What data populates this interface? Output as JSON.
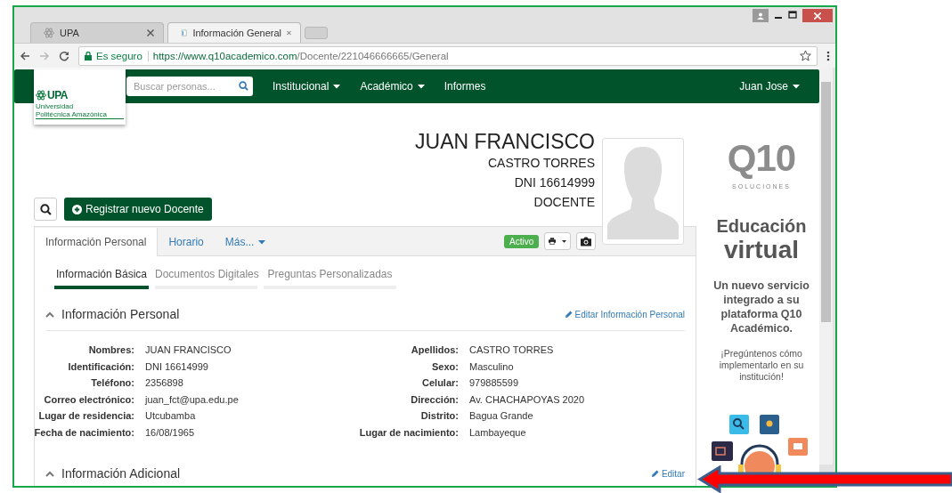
{
  "browser": {
    "tabs": [
      {
        "title": "UPA",
        "selected": false
      },
      {
        "title": "Información General",
        "selected": true
      }
    ],
    "security_label": "Es seguro",
    "url": {
      "host": "https://www.q10academico.com",
      "path": "/Docente/221046666665/General"
    }
  },
  "navbar": {
    "logo": {
      "text": "UPA",
      "subtitle_1": "Universidad",
      "subtitle_2": "Politécnica Amazónica"
    },
    "search": {
      "placeholder": "Buscar personas..."
    },
    "menu": [
      {
        "label": "Institucional",
        "dropdown": true
      },
      {
        "label": "Académico",
        "dropdown": true
      },
      {
        "label": "Informes",
        "dropdown": false
      }
    ],
    "user": {
      "label": "Juan Jose",
      "dropdown": true
    }
  },
  "profile_header": {
    "name": "JUAN FRANCISCO",
    "surname": "CASTRO TORRES",
    "document": "DNI 16614999",
    "role": "DOCENTE"
  },
  "register_button": "Registrar nuevo Docente",
  "tabs": [
    {
      "label": "Información Personal",
      "selected": true,
      "dropdown": false
    },
    {
      "label": "Horario",
      "selected": false,
      "dropdown": false
    },
    {
      "label": "Más...",
      "selected": false,
      "dropdown": true
    }
  ],
  "status_badge": "Activo",
  "subtabs": [
    {
      "label": "Información Básica",
      "selected": true
    },
    {
      "label": "Documentos Digitales",
      "selected": false
    },
    {
      "label": "Preguntas Personalizadas",
      "selected": false
    }
  ],
  "sections": [
    {
      "title": "Información Personal",
      "expanded": true,
      "edit_link": "Editar Información Personal",
      "left_fields": [
        {
          "label": "Nombres:",
          "value": "JUAN FRANCISCO"
        },
        {
          "label": "Identificación:",
          "value": "DNI 16614999"
        },
        {
          "label": "Teléfono:",
          "value": "2356898"
        },
        {
          "label": "Correo electrónico:",
          "value": "juan_fct@upa.edu.pe"
        },
        {
          "label": "Lugar de residencia:",
          "value": "Utcubamba"
        },
        {
          "label": "Fecha de nacimiento:",
          "value": "16/08/1965"
        }
      ],
      "right_fields": [
        {
          "label": "Apellidos:",
          "value": "CASTRO TORRES"
        },
        {
          "label": "Sexo:",
          "value": "Masculino"
        },
        {
          "label": "Celular:",
          "value": "979885599"
        },
        {
          "label": "Dirección:",
          "value": "Av. CHACHAPOYAS 2020"
        },
        {
          "label": "Distrito:",
          "value": "Bagua Grande"
        },
        {
          "label": "Lugar de nacimiento:",
          "value": "Lambayeque"
        }
      ]
    },
    {
      "title": "Información Adicional",
      "expanded": true,
      "edit_link": "Editar"
    }
  ],
  "ad": {
    "logo_text": "Q10",
    "logo_tagline": "SOLUCIONES",
    "heading_1": "Educación",
    "heading_2": "virtual",
    "body": "Un nuevo servicio integrado a su plataforma Q10 Académico.",
    "cta": "¡Pregúntenos cómo implementarlo en su institución!"
  }
}
